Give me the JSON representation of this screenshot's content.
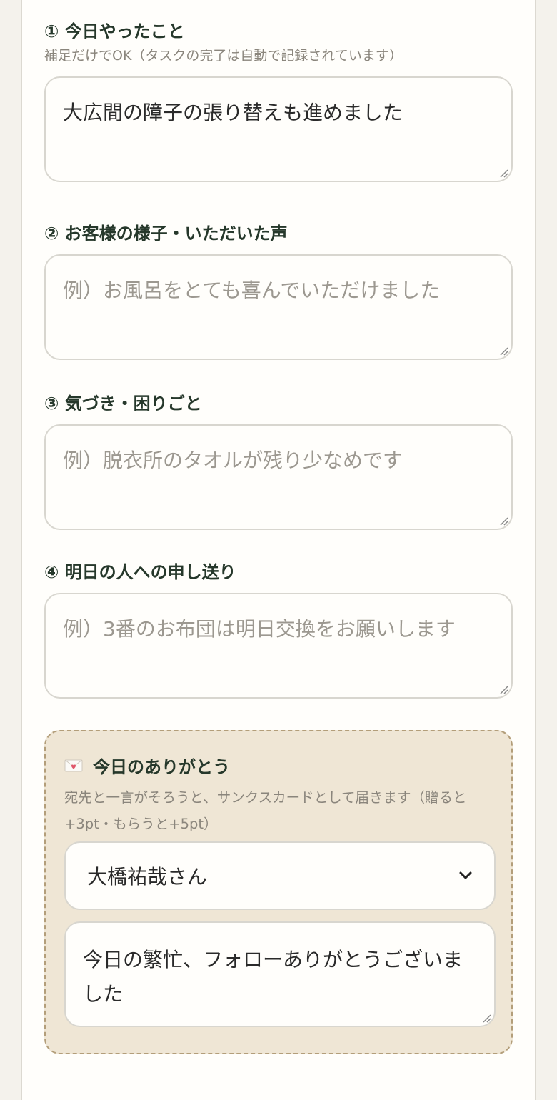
{
  "q1": {
    "label": "① 今日やったこと",
    "hint": "補足だけでOK（タスクの完了は自動で記録されています）",
    "value": "大広間の障子の張り替えも進めました"
  },
  "q2": {
    "label": "② お客様の様子・いただいた声",
    "placeholder": "例）お風呂をとても喜んでいただけました"
  },
  "q3": {
    "label": "③ 気づき・困りごと",
    "placeholder": "例）脱衣所のタオルが残り少なめです"
  },
  "q4": {
    "label": "④ 明日の人への申し送り",
    "placeholder": "例）3番のお布団は明日交換をお願いします"
  },
  "thanks": {
    "icon": "envelope-heart-icon",
    "title": "今日のありがとう",
    "hint": "宛先と一言がそろうと、サンクスカードとして届きます（贈ると+3pt・もらうと+5pt）",
    "recipient": "大橋祐哉さん",
    "message": "今日の繁忙、フォローありがとうございました"
  },
  "colors": {
    "label": "#26382b",
    "hint": "#8a857c",
    "thanks_bg": "#efe6d5",
    "thanks_border": "#b39e7a"
  }
}
